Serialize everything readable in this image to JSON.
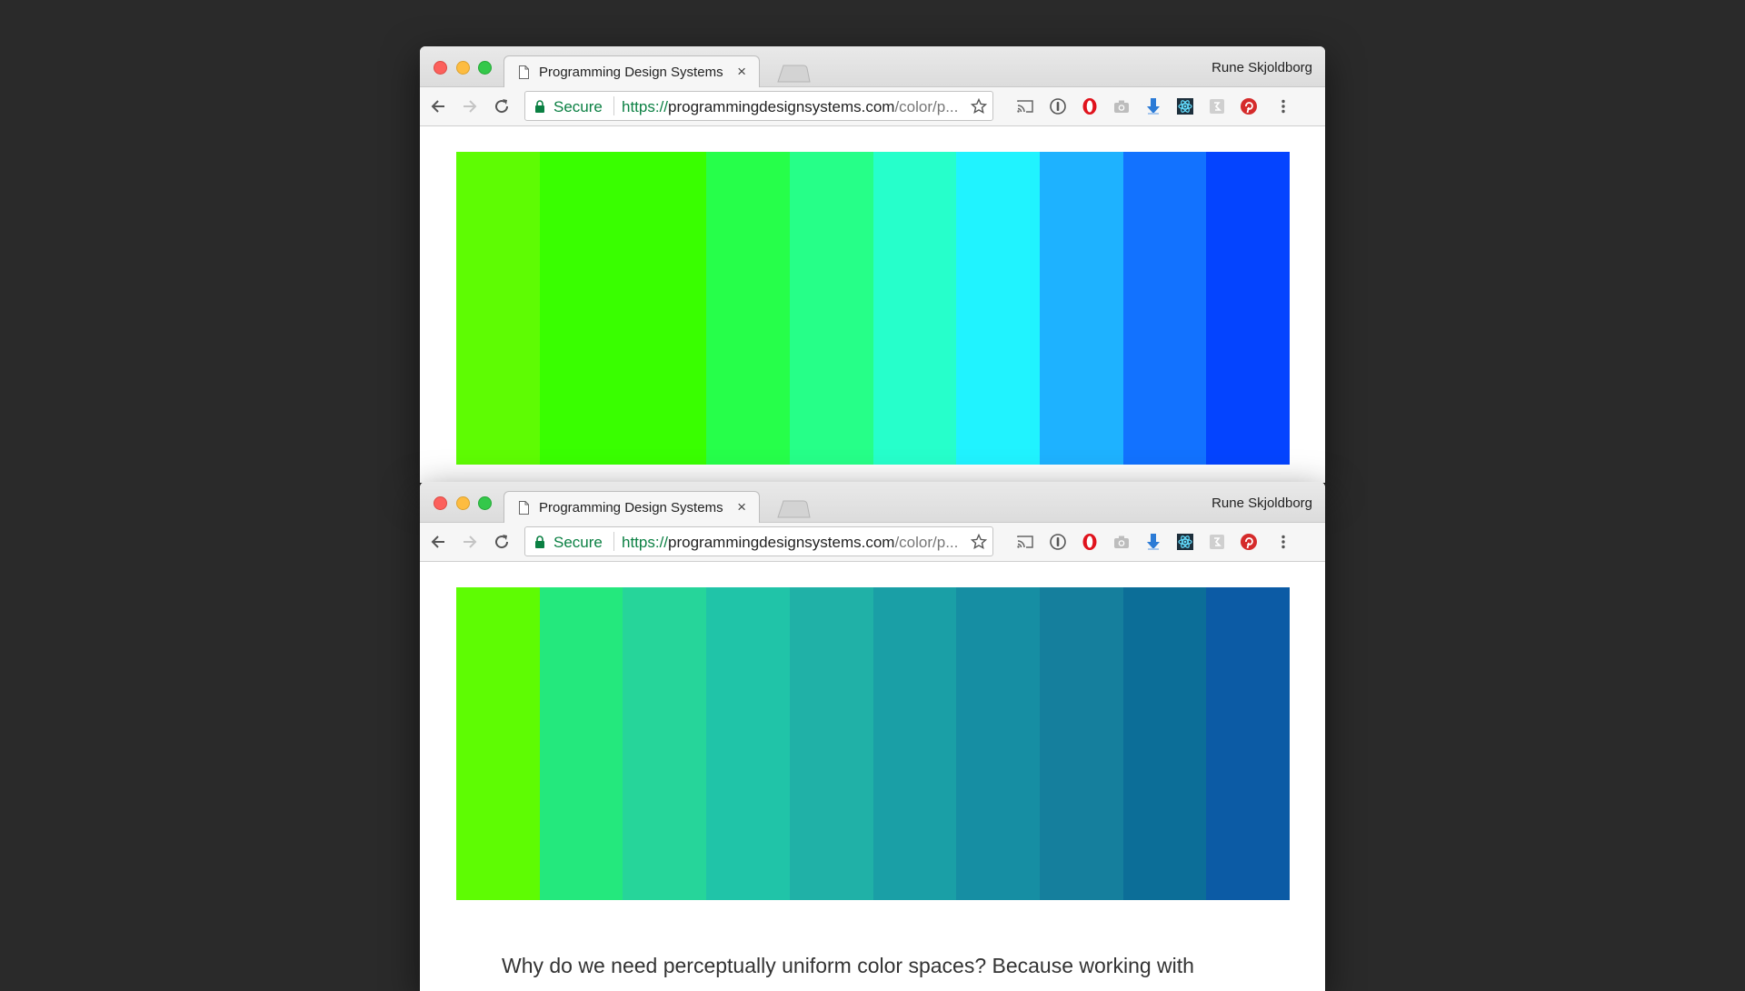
{
  "windows": [
    {
      "tab_title": "Programming Design Systems",
      "tab_close": "×",
      "profile_name": "Rune Skjoldborg",
      "secure_label": "Secure",
      "url_scheme": "https://",
      "url_host": "programmingdesignsystems.com",
      "url_path": "/color/p...",
      "swatches": [
        "#5efc03",
        "#39ff00",
        "#39ff00",
        "#26ff4a",
        "#26ff88",
        "#26ffcb",
        "#20f3ff",
        "#1eb2ff",
        "#1272ff",
        "#0444ff"
      ],
      "paragraph": ""
    },
    {
      "tab_title": "Programming Design Systems",
      "tab_close": "×",
      "profile_name": "Rune Skjoldborg",
      "secure_label": "Secure",
      "url_scheme": "https://",
      "url_host": "programmingdesignsystems.com",
      "url_path": "/color/p...",
      "swatches": [
        "#5efc03",
        "#24e87d",
        "#26d59a",
        "#20c4a8",
        "#20b1a7",
        "#1a9fa6",
        "#168ea3",
        "#157f9d",
        "#0c6e98",
        "#0c5ba5"
      ],
      "paragraph": "Why do we need perceptually uniform color spaces? Because working with"
    }
  ],
  "icons": {
    "page": "page-icon",
    "new_tab": "new-tab-icon",
    "back": "back-arrow-icon",
    "forward": "forward-arrow-icon",
    "reload": "reload-icon",
    "lock": "lock-icon",
    "star": "star-icon",
    "extensions": [
      "cast-icon",
      "1password-icon",
      "opera-icon",
      "camera-icon",
      "download-icon",
      "react-devtools-icon",
      "extension-icon",
      "pinterest-icon",
      "menu-icon"
    ]
  },
  "colors": {
    "desktop_background": "#2a2a2a",
    "secure_green": "#0b8043",
    "text": "#333333"
  }
}
